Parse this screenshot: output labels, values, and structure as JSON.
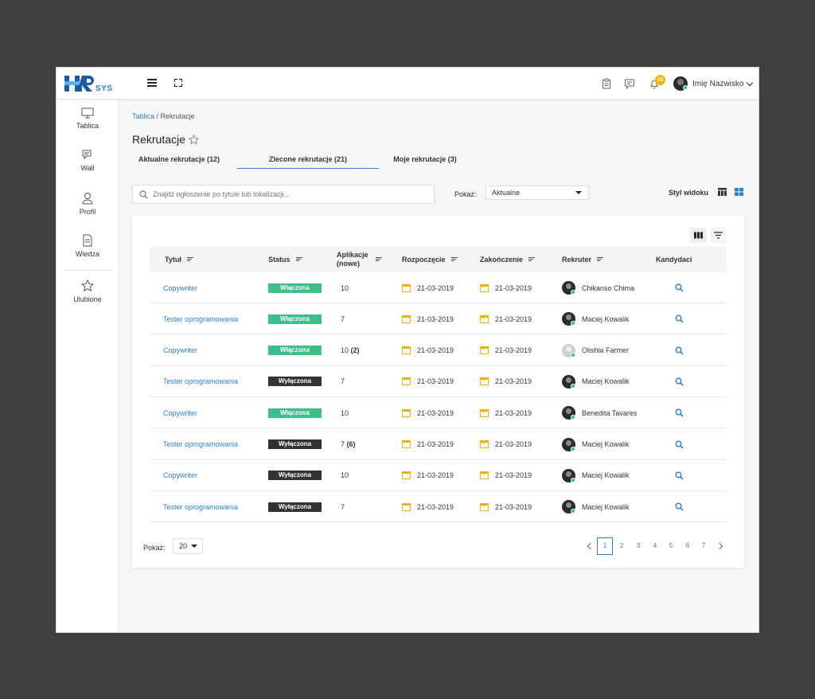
{
  "app": {
    "logo_main": "HR",
    "logo_sub": "SYS"
  },
  "topbar": {
    "notification_count": "10",
    "user_name": "Imię Nazwisko",
    "icons": [
      "clipboard-icon",
      "chat-icon",
      "bell-icon"
    ]
  },
  "sidebar": {
    "items": [
      {
        "label": "Tablica",
        "icon": "monitor-icon"
      },
      {
        "label": "Wall",
        "icon": "chat-bubbles-icon"
      },
      {
        "label": "Profil",
        "icon": "user-icon"
      },
      {
        "label": "Wiedza",
        "icon": "document-icon"
      },
      {
        "label": "Ulubione",
        "icon": "star-icon"
      }
    ]
  },
  "breadcrumb": {
    "root": "Tablica",
    "separator": " / ",
    "current": "Rekrutacje"
  },
  "page": {
    "title": "Rekrutacje"
  },
  "tabs": [
    {
      "label": "Aktualne rekrutacje (12)",
      "active": false
    },
    {
      "label": "Zlecone rekrutacje (21)",
      "active": true
    },
    {
      "label": "Moje rekrutacje (3)",
      "active": false
    }
  ],
  "filters": {
    "search_placeholder": "Znajdź ogłoszenie po tytule lub lokalizacji...",
    "show_label": "Pokaż:",
    "show_value": "Aktualne",
    "view_style_label": "Styl widoku"
  },
  "table": {
    "columns": [
      "Tytuł",
      "Status",
      "Aplikacje (nowe)",
      "Rozpoczęcie",
      "Zakończenie",
      "Rekruter",
      "Kandydaci"
    ],
    "rows": [
      {
        "title": "Copywriter",
        "status": "Włączona",
        "status_on": true,
        "apps": "10",
        "apps_new": "",
        "start": "21-03-2019",
        "end": "21-03-2019",
        "recruiter": "Chikanso Chima"
      },
      {
        "title": "Tester oprogramowania",
        "status": "Włączona",
        "status_on": true,
        "apps": "7",
        "apps_new": "",
        "start": "21-03-2019",
        "end": "21-03-2019",
        "recruiter": "Maciej Kowalik"
      },
      {
        "title": "Copywriter",
        "status": "Włączona",
        "status_on": true,
        "apps": "10",
        "apps_new": "(2)",
        "start": "21-03-2019",
        "end": "21-03-2019",
        "recruiter": "Olishia Farmer"
      },
      {
        "title": "Tester oprogramowania",
        "status": "Wyłączona",
        "status_on": false,
        "apps": "7",
        "apps_new": "",
        "start": "21-03-2019",
        "end": "21-03-2019",
        "recruiter": "Maciej Kowalik"
      },
      {
        "title": "Copywriter",
        "status": "Włączona",
        "status_on": true,
        "apps": "10",
        "apps_new": "",
        "start": "21-03-2019",
        "end": "21-03-2019",
        "recruiter": "Benedita Tavares"
      },
      {
        "title": "Tester oprogramowania",
        "status": "Wyłączona",
        "status_on": false,
        "apps": "7",
        "apps_new": "(6)",
        "start": "21-03-2019",
        "end": "21-03-2019",
        "recruiter": "Maciej Kowalik"
      },
      {
        "title": "Copywriter",
        "status": "Wyłączona",
        "status_on": false,
        "apps": "10",
        "apps_new": "",
        "start": "21-03-2019",
        "end": "21-03-2019",
        "recruiter": "Maciej Kowalik"
      },
      {
        "title": "Tester oprogramowania",
        "status": "Wyłączona",
        "status_on": false,
        "apps": "7",
        "apps_new": "",
        "start": "21-03-2019",
        "end": "21-03-2019",
        "recruiter": "Maciej Kowalik"
      }
    ]
  },
  "footer": {
    "show_label": "Pokaż:",
    "page_size": "20",
    "pages": [
      "1",
      "2",
      "3",
      "4",
      "5",
      "6",
      "7"
    ],
    "current_page": "1"
  },
  "colors": {
    "accent": "#2a7fcf",
    "enabled": "#3dbf8a",
    "disabled": "#333333",
    "calendar": "#f0b400",
    "badge": "#f0b400"
  }
}
